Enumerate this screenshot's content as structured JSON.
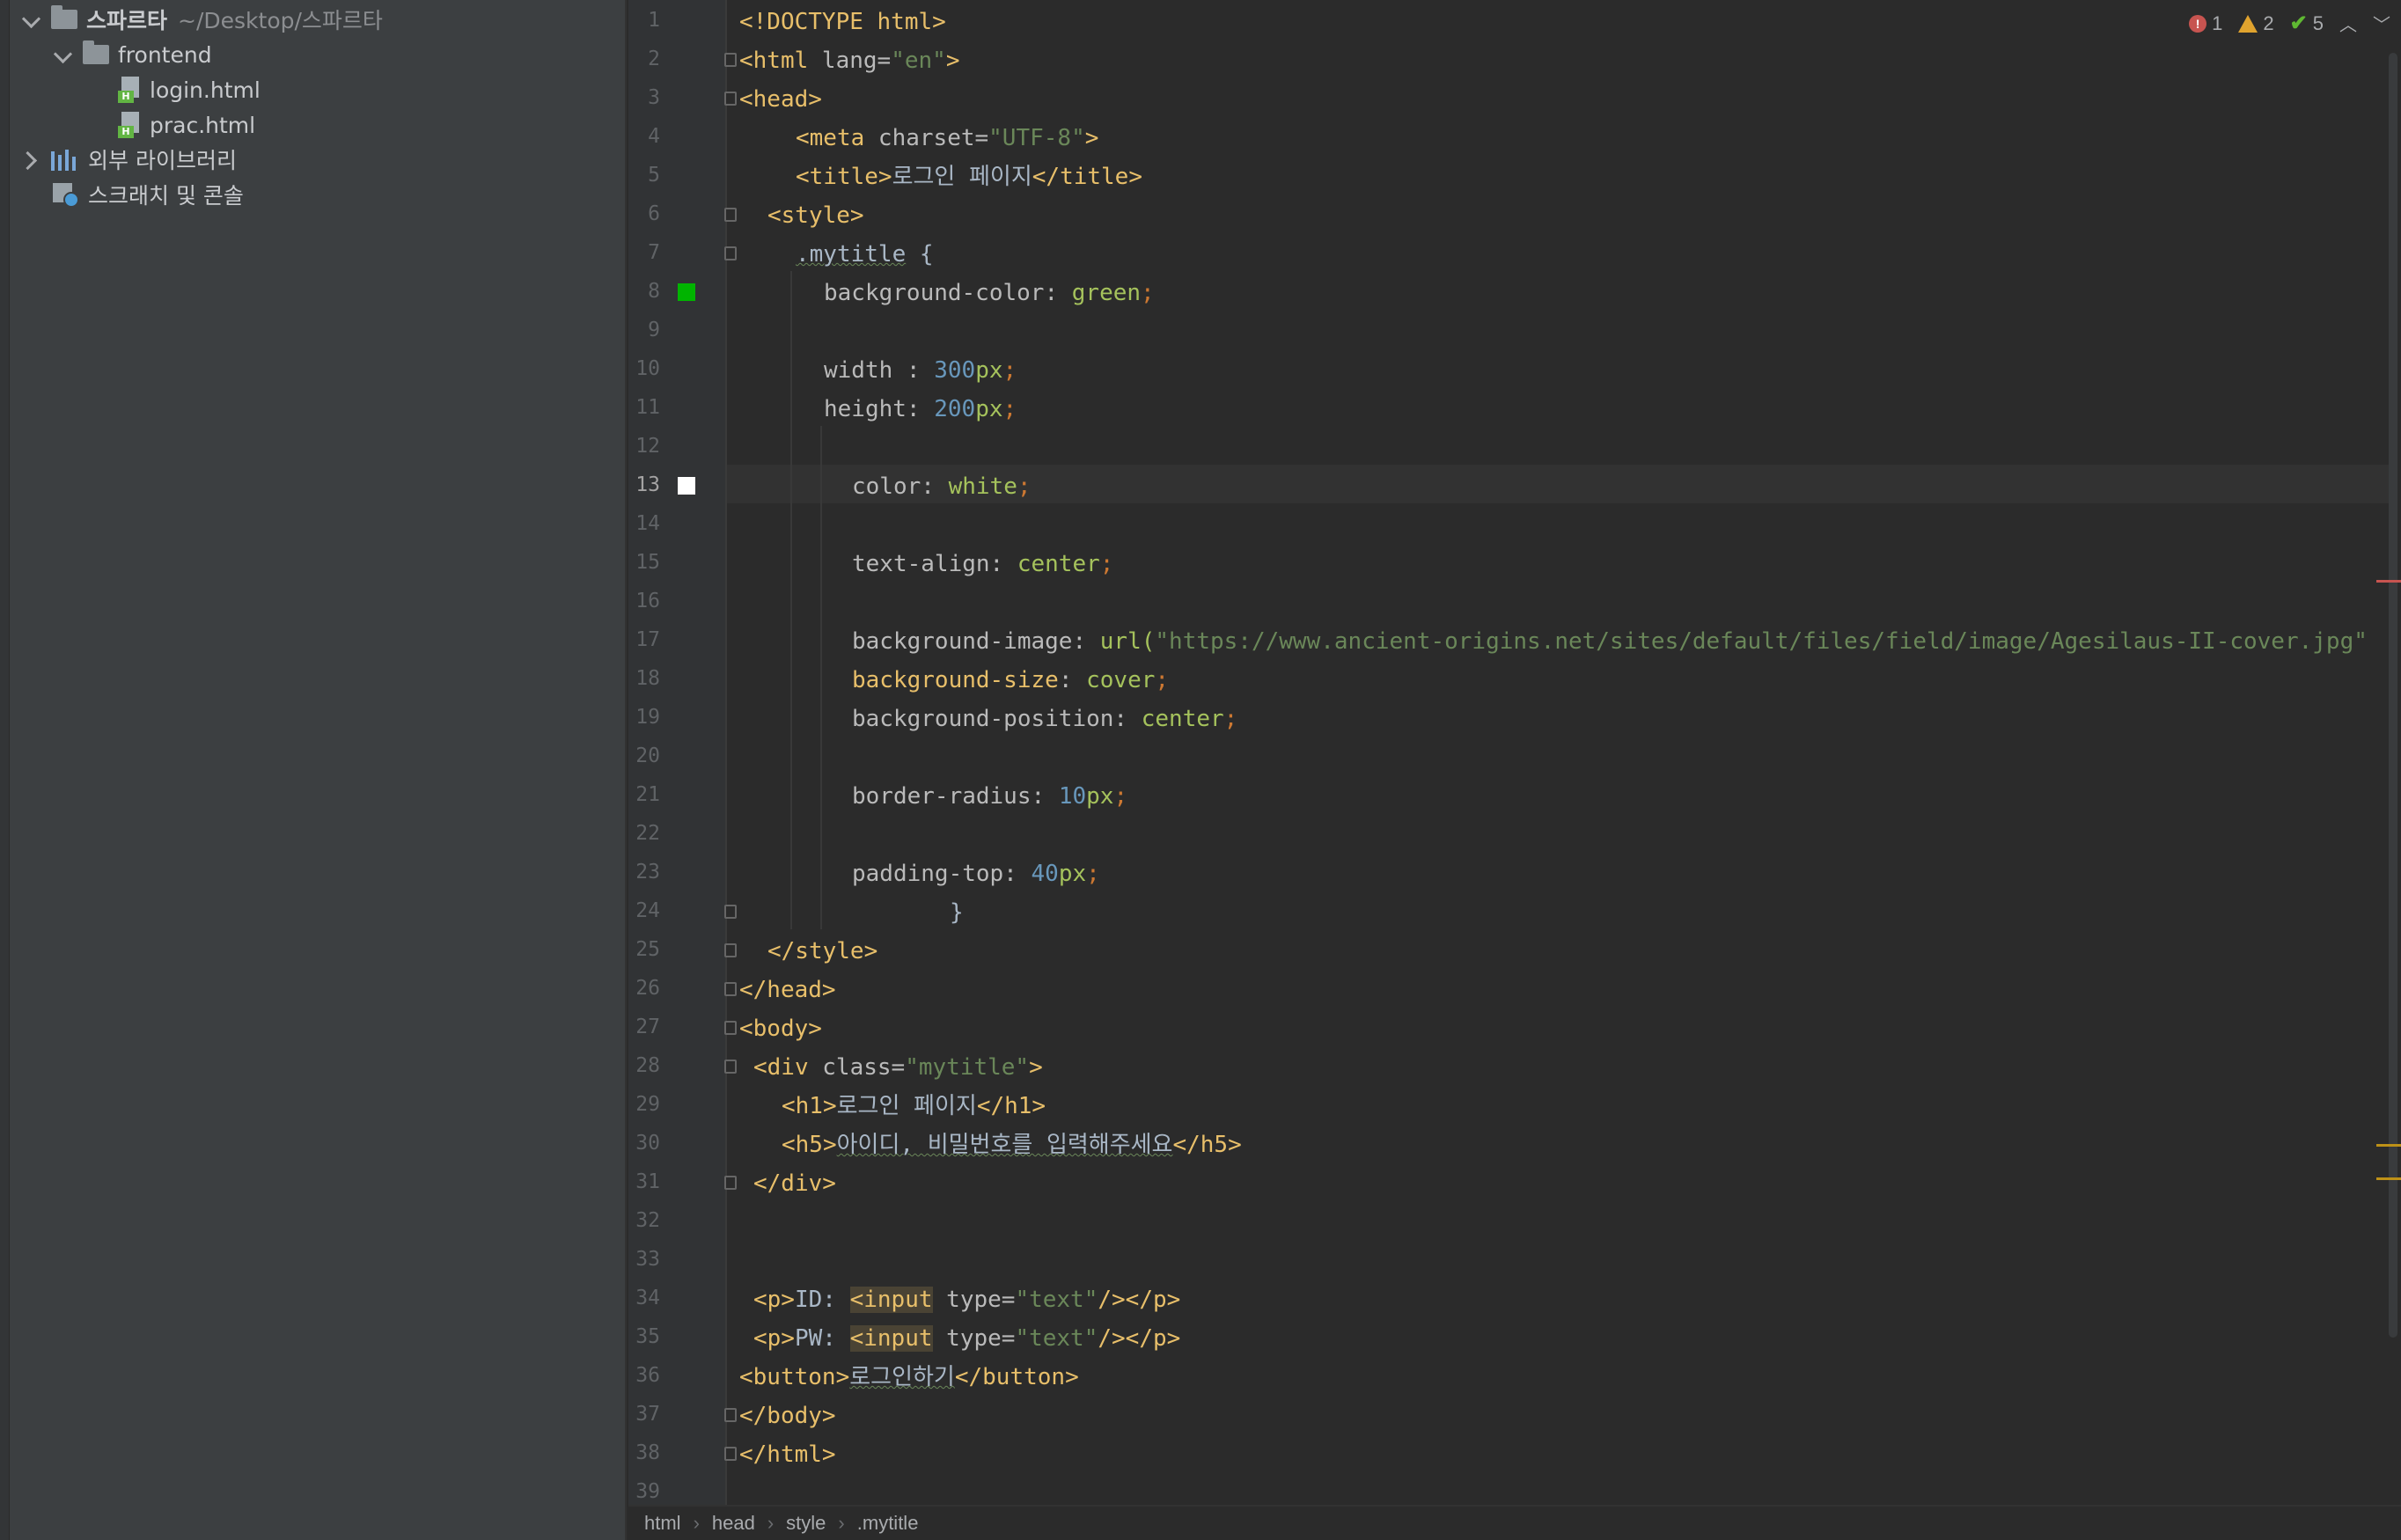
{
  "project_tree": {
    "root": {
      "name": "스파르타",
      "path": "~/Desktop/스파르타"
    },
    "folder": "frontend",
    "files": [
      "login.html",
      "prac.html"
    ],
    "external_libraries": "외부 라이브러리",
    "scratches": "스크래치 및 콘솔"
  },
  "inspections": {
    "errors": "1",
    "warnings": "2",
    "ok": "5"
  },
  "line_numbers": [
    "1",
    "2",
    "3",
    "4",
    "5",
    "6",
    "7",
    "8",
    "9",
    "10",
    "11",
    "12",
    "13",
    "14",
    "15",
    "16",
    "17",
    "18",
    "19",
    "20",
    "21",
    "22",
    "23",
    "24",
    "25",
    "26",
    "27",
    "28",
    "29",
    "30",
    "31",
    "32",
    "33",
    "34",
    "35",
    "36",
    "37",
    "38",
    "39"
  ],
  "code": {
    "l1": "<!DOCTYPE html>",
    "l2_tag": "<html ",
    "l2_attr": "lang=",
    "l2_str": "\"en\"",
    "l2_end": ">",
    "l3": "<head>",
    "l4_tag": "<meta ",
    "l4_attr": "charset=",
    "l4_str": "\"UTF-8\"",
    "l4_end": ">",
    "l5_open": "<title>",
    "l5_text": "로그인 페이지",
    "l5_close": "</title>",
    "l6": "<style>",
    "l7_sel": ".mytitle",
    "l7_brace": " {",
    "l8_prop": "background-color: ",
    "l8_val": "green",
    "l8_semi": ";",
    "l10_prop": "width : ",
    "l10_num": "300",
    "l10_unit": "px",
    "l10_semi": ";",
    "l11_prop": "height: ",
    "l11_num": "200",
    "l11_unit": "px",
    "l11_semi": ";",
    "l13_prop": "color: ",
    "l13_val": "white",
    "l13_semi": ";",
    "l15_prop": "text-align: ",
    "l15_val": "center",
    "l15_semi": ";",
    "l17_prop": "background-image: ",
    "l17_fn": "url(",
    "l17_str": "\"https://www.ancient-origins.net/sites/default/files/field/image/Agesilaus-II-cover.jpg\"",
    "l18_prop": "background-size",
    "l18_colon": ": ",
    "l18_val": "cover",
    "l18_semi": ";",
    "l19_prop": "background-position: ",
    "l19_val": "center",
    "l19_semi": ";",
    "l21_prop": "border-radius: ",
    "l21_num": "10",
    "l21_unit": "px",
    "l21_semi": ";",
    "l23_prop": "padding-top: ",
    "l23_num": "40",
    "l23_unit": "px",
    "l23_semi": ";",
    "l24": "}",
    "l25": "</style>",
    "l26": "</head>",
    "l27": "<body>",
    "l28_tag": "<div ",
    "l28_attr": "class=",
    "l28_str": "\"mytitle\"",
    "l28_end": ">",
    "l29_open": "<h1>",
    "l29_text": "로그인 페이지",
    "l29_close": "</h1>",
    "l30_open": "<h5>",
    "l30_text": "아이디, 비밀번호를 입력해주세요",
    "l30_close": "</h5>",
    "l31": "</div>",
    "l34_open": "<p>",
    "l34_text": "ID: ",
    "l34_in": "<input",
    "l34_attr": " type=",
    "l34_str": "\"text\"",
    "l34_close": "/></p>",
    "l35_open": "<p>",
    "l35_text": "PW: ",
    "l35_in": "<input",
    "l35_attr": " type=",
    "l35_str": "\"text\"",
    "l35_close": "/></p>",
    "l36_open": "<button>",
    "l36_text": "로그인하기",
    "l36_close": "</button>",
    "l37": "</body>",
    "l38": "</html>"
  },
  "breadcrumb": [
    "html",
    "head",
    "style",
    ".mytitle"
  ],
  "colors": {
    "swatch_green": "#00b400",
    "swatch_white": "#ffffff"
  }
}
